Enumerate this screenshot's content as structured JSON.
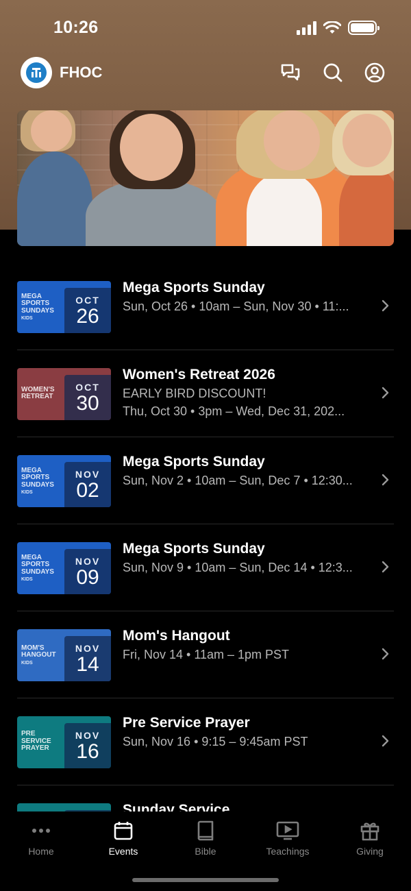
{
  "status": {
    "time": "10:26"
  },
  "app": {
    "name": "FHOC"
  },
  "header_icons": [
    "chat-icon",
    "search-icon",
    "profile-icon"
  ],
  "events": [
    {
      "title": "Mega Sports Sunday",
      "lines": [
        "Sun, Oct 26 • 10am – Sun, Nov 30 • 11:..."
      ],
      "month": "OCT",
      "day": "26",
      "thumb_text": "MEGA SPORTS SUNDAYS",
      "thumb_sub": "KIDS",
      "thumb_color": "#1e5fc4"
    },
    {
      "title": "Women's Retreat 2026",
      "lines": [
        "EARLY BIRD DISCOUNT!",
        "Thu, Oct 30 • 3pm – Wed, Dec 31, 202..."
      ],
      "month": "OCT",
      "day": "30",
      "thumb_text": "WOMEN'S RETREAT",
      "thumb_sub": "",
      "thumb_color": "#8a3d42"
    },
    {
      "title": "Mega Sports Sunday",
      "lines": [
        "Sun, Nov 2 • 10am – Sun, Dec 7 • 12:30..."
      ],
      "month": "NOV",
      "day": "02",
      "thumb_text": "MEGA SPORTS SUNDAYS",
      "thumb_sub": "KIDS",
      "thumb_color": "#1e5fc4"
    },
    {
      "title": "Mega Sports Sunday",
      "lines": [
        "Sun, Nov 9 • 10am – Sun, Dec 14 • 12:3..."
      ],
      "month": "NOV",
      "day": "09",
      "thumb_text": "MEGA SPORTS SUNDAYS",
      "thumb_sub": "KIDS",
      "thumb_color": "#1e5fc4"
    },
    {
      "title": "Mom's Hangout",
      "lines": [
        "Fri, Nov 14 • 11am – 1pm PST"
      ],
      "month": "NOV",
      "day": "14",
      "thumb_text": "MOM'S HANGOUT",
      "thumb_sub": "KIDS",
      "thumb_color": "#2f6bc2"
    },
    {
      "title": "Pre Service Prayer",
      "lines": [
        "Sun, Nov 16 • 9:15 – 9:45am PST"
      ],
      "month": "NOV",
      "day": "16",
      "thumb_text": "PRE SERVICE PRAYER",
      "thumb_sub": "",
      "thumb_color": "#0e7b80"
    },
    {
      "title": "Sunday Service",
      "lines": [
        ""
      ],
      "month": "",
      "day": "",
      "thumb_text": "",
      "thumb_sub": "",
      "thumb_color": "#0e7b80"
    }
  ],
  "tabs": [
    {
      "label": "Home",
      "icon": "more-dots-icon",
      "active": false
    },
    {
      "label": "Events",
      "icon": "calendar-icon",
      "active": true
    },
    {
      "label": "Bible",
      "icon": "book-icon",
      "active": false
    },
    {
      "label": "Teachings",
      "icon": "tv-play-icon",
      "active": false
    },
    {
      "label": "Giving",
      "icon": "gift-icon",
      "active": false
    }
  ]
}
